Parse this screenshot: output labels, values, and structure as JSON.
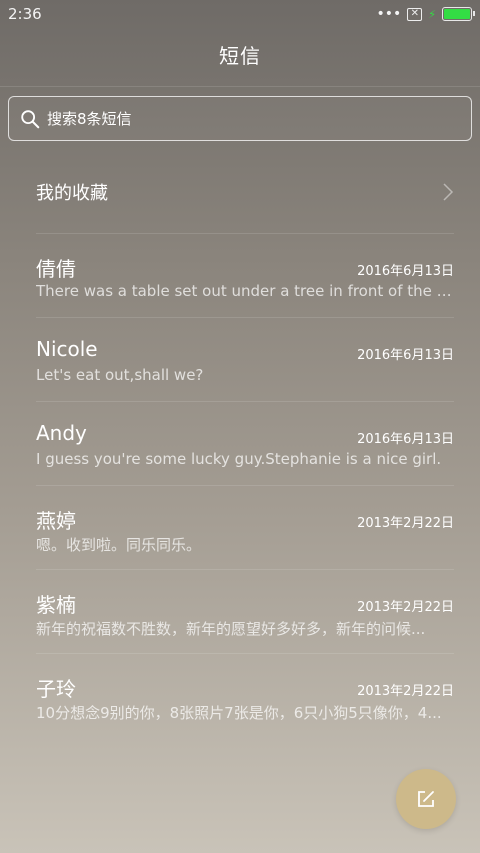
{
  "status_bar": {
    "time": "2:36",
    "dots": "•••",
    "battery_level": 1.0,
    "battery_color": "#33dd44"
  },
  "header": {
    "title": "短信"
  },
  "search": {
    "placeholder": "搜索8条短信"
  },
  "favorites": {
    "label": "我的收藏"
  },
  "conversations": [
    {
      "name": "倩倩",
      "date": "2016年6月13日",
      "preview": "There was a table set out under a tree in front of the ho..."
    },
    {
      "name": "Nicole",
      "date": "2016年6月13日",
      "preview": "Let's eat out,shall we?"
    },
    {
      "name": "Andy",
      "date": "2016年6月13日",
      "preview": "I guess you're some lucky guy.Stephanie is a nice girl."
    },
    {
      "name": "燕婷",
      "date": "2013年2月22日",
      "preview": "嗯。收到啦。同乐同乐。"
    },
    {
      "name": "紫楠",
      "date": "2013年2月22日",
      "preview": "新年的祝福数不胜数，新年的愿望好多好多，新年的问候..."
    },
    {
      "name": "子玲",
      "date": "2013年2月22日",
      "preview": "10分想念9别的你，8张照片7张是你，6只小狗5只像你，4..."
    }
  ],
  "icons": {
    "search": "search-icon",
    "chevron": "chevron-right-icon",
    "compose": "compose-icon"
  },
  "colors": {
    "fab": "#cdb98a",
    "text": "#ffffff"
  }
}
